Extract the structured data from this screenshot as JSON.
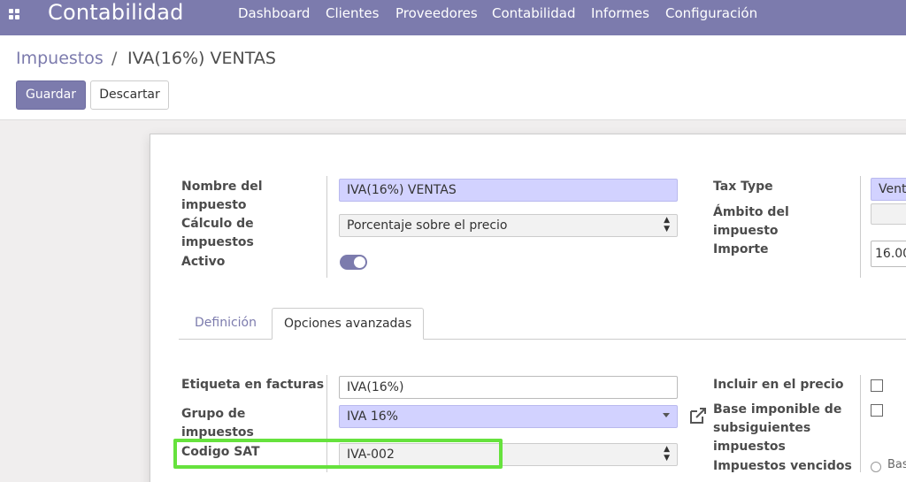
{
  "nav": {
    "app_title": "Contabilidad",
    "items": [
      "Dashboard",
      "Clientes",
      "Proveedores",
      "Contabilidad",
      "Informes",
      "Configuración"
    ]
  },
  "breadcrumb": {
    "parent": "Impuestos",
    "separator": "/",
    "current": "IVA(16%) VENTAS"
  },
  "buttons": {
    "save": "Guardar",
    "discard": "Descartar"
  },
  "form": {
    "name_label": "Nombre del\nimpuesto",
    "name_value": "IVA(16%) VENTAS",
    "calc_label": "Cálculo de\nimpuestos",
    "calc_value": "Porcentaje sobre el precio",
    "active_label": "Activo",
    "active_value": true,
    "tax_type_label": "Tax Type",
    "tax_type_value": "Vent",
    "scope_label": "Ámbito del\nimpuesto",
    "scope_value": "",
    "amount_label": "Importe",
    "amount_value": "16.00"
  },
  "tabs": [
    {
      "label": "Definición",
      "active": false
    },
    {
      "label": "Opciones avanzadas",
      "active": true
    }
  ],
  "advanced": {
    "invoice_label_label": "Etiqueta en facturas",
    "invoice_label_value": "IVA(16%)",
    "group_label": "Grupo de\nimpuestos",
    "group_value": "IVA 16%",
    "sat_label": "Codigo SAT",
    "sat_value": "IVA-002",
    "include_price_label": "Incluir en el precio",
    "include_price_checked": false,
    "base_label": "Base imponible de\nsubsiguientes\nimpuestos",
    "base_checked": false,
    "due_label": "Impuestos vencidos",
    "due_option": "Bas"
  },
  "colors": {
    "brand": "#7c7bad",
    "required_field": "#d2d2ff",
    "highlight": "#66e23d"
  },
  "icons": [
    "apps-grid-icon",
    "external-link-icon",
    "select-caret-icon",
    "dropdown-caret-icon"
  ]
}
